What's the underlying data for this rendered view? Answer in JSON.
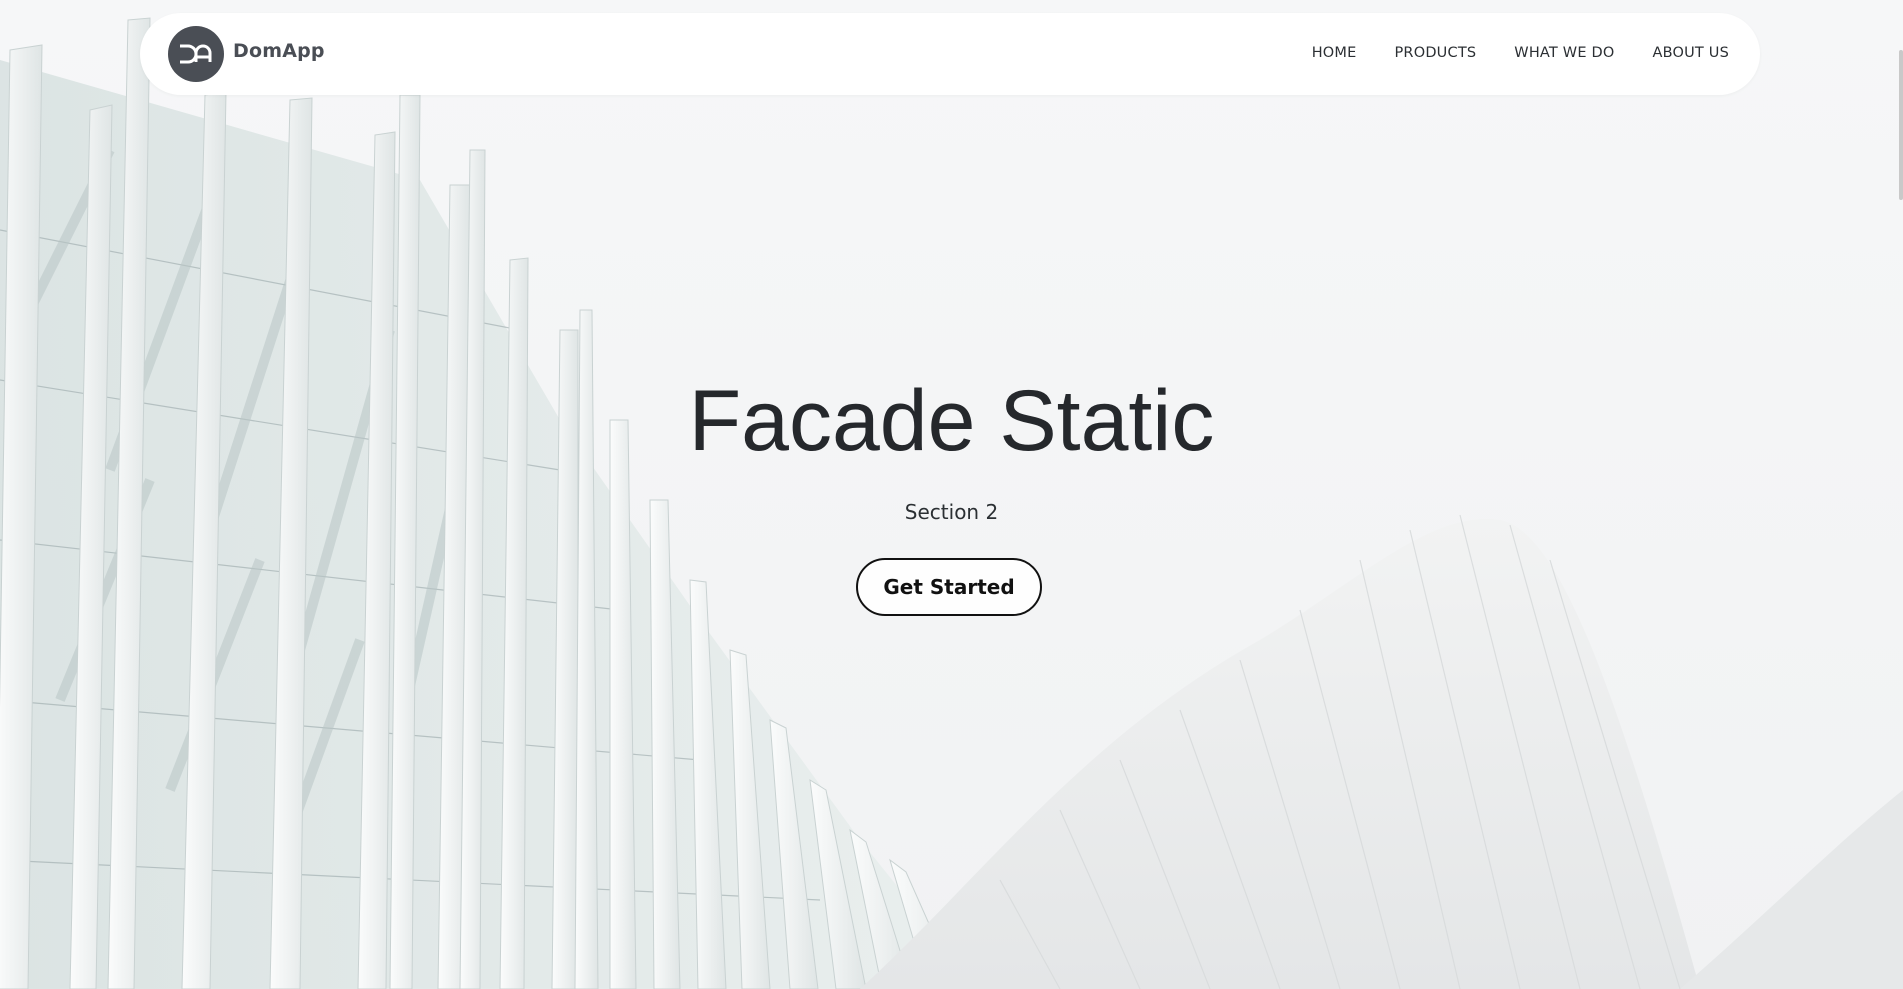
{
  "brand": {
    "logo_initials": "DA",
    "name": "DomApp",
    "logo_color": "#4a4e55"
  },
  "nav": {
    "items": [
      {
        "label": "HOME"
      },
      {
        "label": "PRODUCTS"
      },
      {
        "label": "WHAT WE DO"
      },
      {
        "label": "ABOUT US"
      }
    ]
  },
  "hero": {
    "title": "Facade Static",
    "subtitle": "Section 2",
    "cta_label": "Get Started",
    "background": "white architectural facade with vertical glass fins"
  },
  "colors": {
    "page_bg": "#f3f4f5",
    "text_dark": "#25282c",
    "button_border": "#111111"
  }
}
